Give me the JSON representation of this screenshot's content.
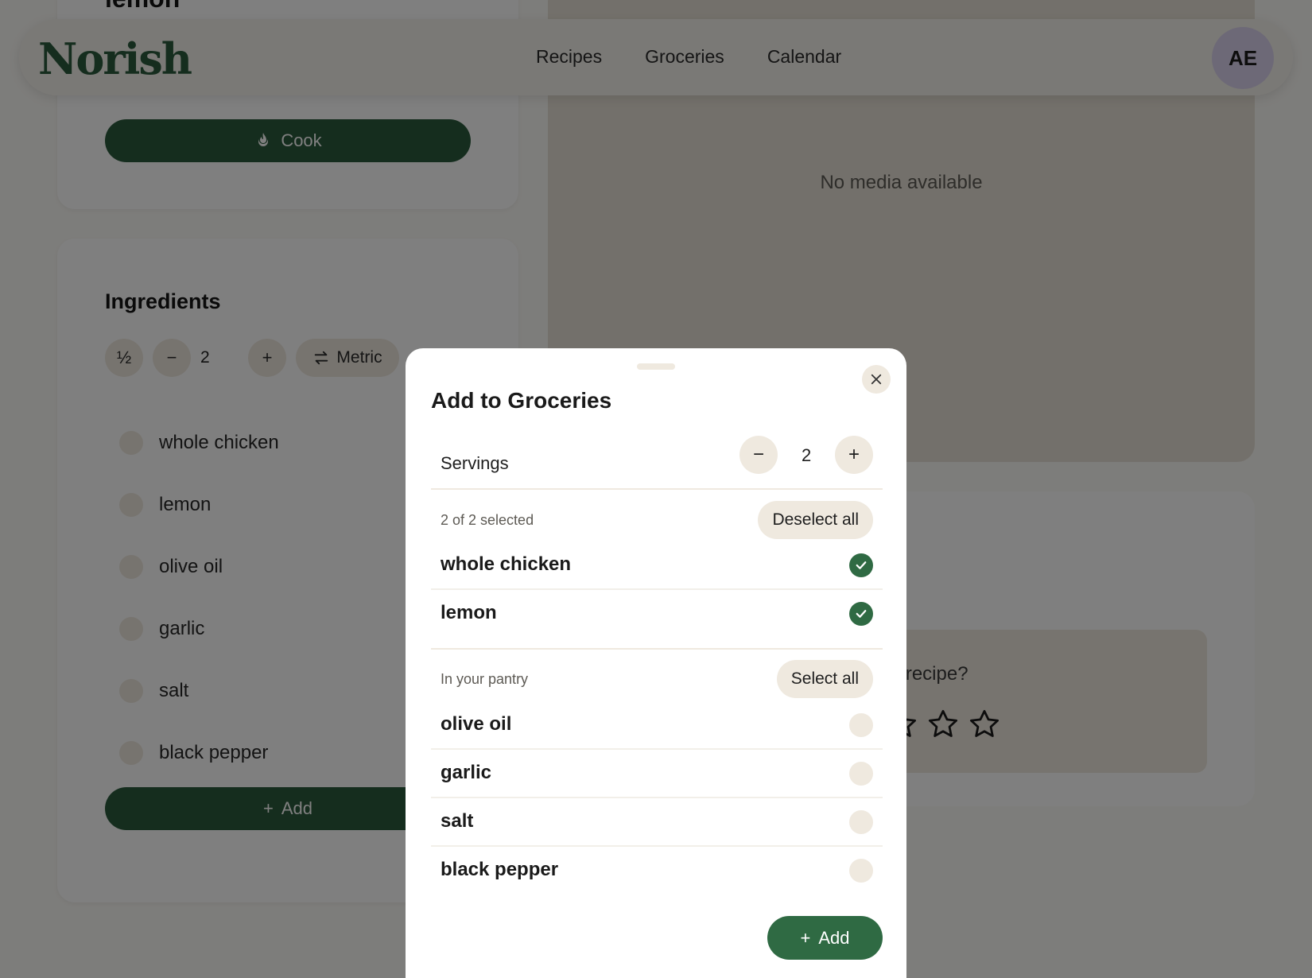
{
  "app": {
    "logo": "Norish"
  },
  "nav": {
    "links": [
      "Recipes",
      "Groceries",
      "Calendar"
    ],
    "avatar_initials": "AE"
  },
  "recipe": {
    "title": "lemon",
    "cook_label": "Cook",
    "ingredients_title": "Ingredients",
    "half_label": "½",
    "servings": "2",
    "units_label": "Metric",
    "ingredients": [
      "whole chicken",
      "lemon",
      "olive oil",
      "garlic",
      "salt",
      "black pepper"
    ],
    "add_label": "Add"
  },
  "media": {
    "empty_text": "No media available"
  },
  "rating": {
    "question": "k of this recipe?",
    "max_stars": 5
  },
  "modal": {
    "title": "Add to Groceries",
    "servings_label": "Servings",
    "servings_value": "2",
    "selected_summary": "2 of 2 selected",
    "deselect_all_label": "Deselect all",
    "selected_items": [
      "whole chicken",
      "lemon"
    ],
    "pantry_label": "In your pantry",
    "select_all_label": "Select all",
    "pantry_items": [
      "olive oil",
      "garlic",
      "salt",
      "black pepper"
    ],
    "add_label": "Add"
  },
  "colors": {
    "brand_green": "#2b5a3c",
    "accent_green": "#2f6a43",
    "chip": "#efe9df",
    "avatar": "#dad3ee"
  }
}
